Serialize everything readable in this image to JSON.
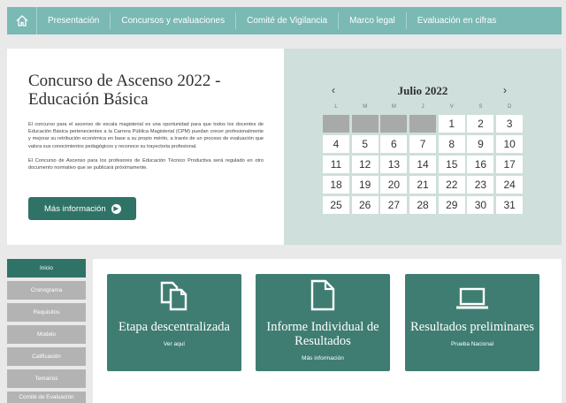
{
  "nav": {
    "items": [
      "Presentación",
      "Concursos y evaluaciones",
      "Comité de Vigilancia",
      "Marco legal",
      "Evaluación en cifras"
    ]
  },
  "hero": {
    "title": "Concurso de Ascenso 2022 - Educación Básica",
    "paragraph1": "El concurso para el ascenso de escala magisterial es una oportunidad para que todos los docentes de Educación Básica pertenecientes a la Carrera Pública Magisterial (CPM) puedan crecer profesionalmente y mejorar su retribución económica en base a su propio mérito, a través de un proceso de evaluación que valora sus conocimientos pedagógicos y reconoce su trayectoria profesional.",
    "paragraph2": "El Concurso de Ascenso para los profesores de Educación Técnico Productiva será regulado en otro documento normativo que se publicará próximamente.",
    "button_label": "Más información"
  },
  "calendar": {
    "month_label": "Julio 2022",
    "prev_glyph": "‹",
    "next_glyph": "›",
    "weekdays": [
      "L",
      "M",
      "M",
      "J",
      "V",
      "S",
      "D"
    ],
    "leading_empty": 4,
    "days": [
      "1",
      "2",
      "3",
      "4",
      "5",
      "6",
      "7",
      "8",
      "9",
      "10",
      "11",
      "12",
      "13",
      "14",
      "15",
      "16",
      "17",
      "18",
      "19",
      "20",
      "21",
      "22",
      "23",
      "24",
      "25",
      "26",
      "27",
      "28",
      "29",
      "30",
      "31"
    ]
  },
  "sidebar": {
    "items": [
      "Inicio",
      "Cronograma",
      "Requisitos",
      "Modelo",
      "Calificación",
      "Temarios",
      "Comité de Evaluación"
    ]
  },
  "cards": [
    {
      "title": "Etapa descentralizada",
      "sub": "Ver aquí",
      "icon": "copy-documents-icon"
    },
    {
      "title": "Informe Individual de Resultados",
      "sub": "Más información",
      "icon": "document-icon"
    },
    {
      "title": "Resultados preliminares",
      "sub": "Prueba Nacional",
      "icon": "laptop-icon"
    }
  ],
  "colors": {
    "nav": "#7ab9b4",
    "accent": "#2f7367",
    "card": "#3f7d72",
    "calendar_bg": "#cfdfdb"
  }
}
